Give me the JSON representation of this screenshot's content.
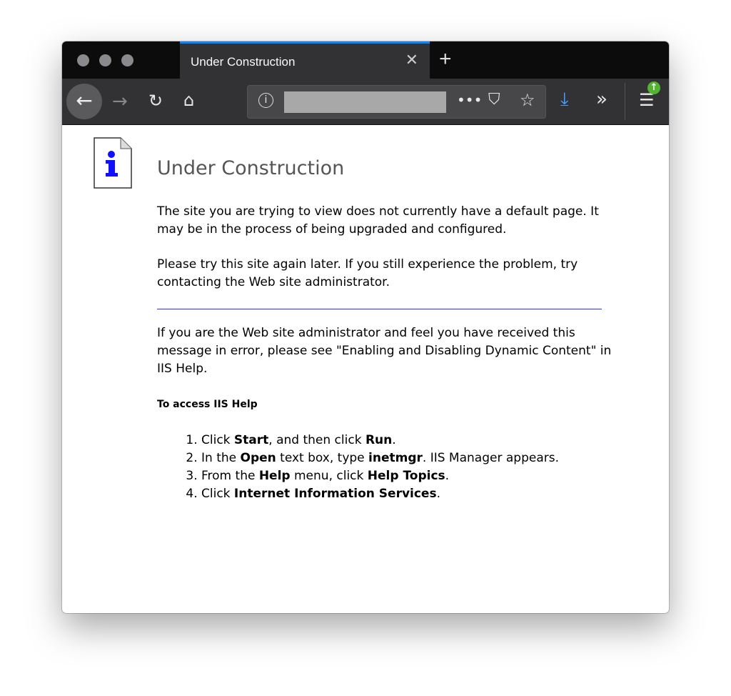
{
  "browser": {
    "tab_title": "Under Construction",
    "accent": "#0a84ff"
  },
  "page": {
    "title": "Under Construction",
    "para1": "The site you are trying to view does not currently have a default page. It may be in the process of being upgraded and configured.",
    "para2": "Please try this site again later. If you still experience the problem, try contacting the Web site administrator.",
    "para3": "If you are the Web site administrator and feel you have received this message in error, please see \"Enabling and Disabling Dynamic Content\" in IIS Help.",
    "help_heading": "To access IIS Help",
    "steps": [
      [
        {
          "t": "Click "
        },
        {
          "t": "Start",
          "b": true
        },
        {
          "t": ", and then click "
        },
        {
          "t": "Run",
          "b": true
        },
        {
          "t": "."
        }
      ],
      [
        {
          "t": "In the "
        },
        {
          "t": "Open",
          "b": true
        },
        {
          "t": " text box, type "
        },
        {
          "t": "inetmgr",
          "b": true
        },
        {
          "t": ". IIS Manager appears."
        }
      ],
      [
        {
          "t": "From the "
        },
        {
          "t": "Help",
          "b": true
        },
        {
          "t": " menu, click "
        },
        {
          "t": "Help Topics",
          "b": true
        },
        {
          "t": "."
        }
      ],
      [
        {
          "t": "Click "
        },
        {
          "t": "Internet Information Services",
          "b": true
        },
        {
          "t": "."
        }
      ]
    ]
  }
}
